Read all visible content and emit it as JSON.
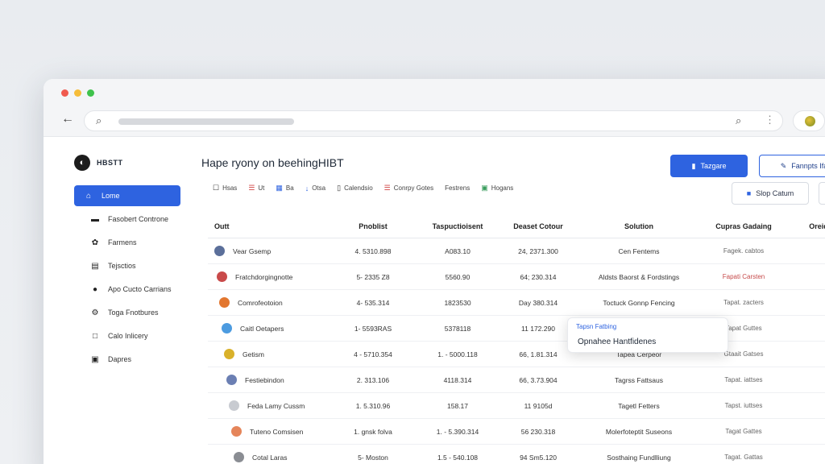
{
  "browser": {
    "back_icon": "arrow-left-icon",
    "search_icon": "search-icon",
    "profile_icon": "avatar-icon"
  },
  "sidebar": {
    "logo_text": "HBSTT",
    "logo_sub": "",
    "items": [
      {
        "label": "Lome",
        "icon": "home-icon",
        "active": true
      },
      {
        "label": "Fasobert Controne",
        "icon": "card-icon",
        "active": false
      },
      {
        "label": "Farmens",
        "icon": "puzzle-icon",
        "active": false
      },
      {
        "label": "Tejsctios",
        "icon": "stack-icon",
        "active": false
      },
      {
        "label": "Apo Cucto Carrians",
        "icon": "user-icon",
        "active": false
      },
      {
        "label": "Toga Fnotbures",
        "icon": "gear-icon",
        "active": false
      },
      {
        "label": "Calo Inlicery",
        "icon": "square-icon",
        "active": false
      },
      {
        "label": "Dapres",
        "icon": "image-icon",
        "active": false
      }
    ]
  },
  "header": {
    "title": "Hape ryony on beehingHIBT",
    "primary_button": "Tazgare",
    "outline_button": "Fannpts Ifa",
    "secondary_button": "Slop Catum"
  },
  "toolbar": [
    {
      "label": "Hsas",
      "icon": "checkbox-icon",
      "color": "#333333"
    },
    {
      "label": "Ut",
      "icon": "bars-icon",
      "color": "#d14444"
    },
    {
      "label": "Ba",
      "icon": "grid-icon",
      "color": "#2e63e0"
    },
    {
      "label": "Otsa",
      "icon": "download-icon",
      "color": "#2e63e0"
    },
    {
      "label": "Calendsio",
      "icon": "calendar-icon",
      "color": "#333333"
    },
    {
      "label": "Conrpy Gotes",
      "icon": "list-icon",
      "color": "#d14444"
    },
    {
      "label": "Festrens",
      "icon": "dot-icon",
      "color": "#333333"
    },
    {
      "label": "Hogans",
      "icon": "chart-icon",
      "color": "#3a9d5d"
    }
  ],
  "table": {
    "headers": [
      "Outt",
      "Pnoblist",
      "Taspuctioisent",
      "Deaset Cotour",
      "Solution",
      "Cupras Gadaing",
      "Oreid"
    ],
    "rows": [
      {
        "icon_color": "#5b6f9a",
        "name": "Vear Gsemp",
        "c1": "4. 5310.898",
        "c2": "A083.10",
        "c3": "24, 2371.300",
        "c4": "Cen Fentems",
        "c5": "Fagek. cabtos",
        "c6": ""
      },
      {
        "icon_color": "#c94a4a",
        "name": "Fratchdorgingnotte",
        "c1": "5- 2335 Z8",
        "c2": "5560.90",
        "c3": "64; 230.314",
        "c4": "Aldsts Baorst & Fordstings",
        "c5": "Fapati Carsten",
        "c6": ""
      },
      {
        "icon_color": "#e2762f",
        "name": "Comrofeotoion",
        "c1": "4- 535.314",
        "c2": "1823530",
        "c3": "Day 380.314",
        "c4": "Toctuck Gonnp Fencing",
        "c5": "Tapat. zacters",
        "c6": ""
      },
      {
        "icon_color": "#4c9be0",
        "name": "Caitl Oetapers",
        "c1": "1- 5593RAS",
        "c2": "5378118",
        "c3": "11 172.290",
        "c4": "",
        "c5": "Tapat Guttes",
        "c6": ""
      },
      {
        "icon_color": "#d9b12a",
        "name": "Getism",
        "c1": "4 - 5710.354",
        "c2": "1. - 5000.118",
        "c3": "66, 1.81.314",
        "c4": "Tapea Cerpeor",
        "c5": "Gtaait Gatses",
        "c6": ""
      },
      {
        "icon_color": "#6b7fb3",
        "name": "Festiebindon",
        "c1": "2. 313.106",
        "c2": "4118.314",
        "c3": "66, 3.73.904",
        "c4": "Tagrss Fattsaus",
        "c5": "Tapat. iattses",
        "c6": ""
      },
      {
        "icon_color": "#c8cbd1",
        "name": "Feda Lamy Cussm",
        "c1": "1. 5.310.96",
        "c2": "158.17",
        "c3": "11 9105d",
        "c4": "Tagetl Fetters",
        "c5": "Tapst. iuttses",
        "c6": ""
      },
      {
        "icon_color": "#e5855a",
        "name": "Tuteno Comsisen",
        "c1": "1. gnsk folva",
        "c2": "1. - 5.390.314",
        "c3": "56 230.318",
        "c4": "Molerfoteptit Suseons",
        "c5": "Tagat Gattes",
        "c6": ""
      },
      {
        "icon_color": "#8a8d93",
        "name": "Cotal Laras",
        "c1": "5- Moston",
        "c2": "1.5 - 540.108",
        "c3": "94 Sm5.120",
        "c4": "Sosthaing Fundlliung",
        "c5": "Tagat. Gattas",
        "c6": ""
      }
    ]
  },
  "dropdown": {
    "item1": "Tapsn Fatbing",
    "item2": "Opnahee Hantfidenes"
  }
}
